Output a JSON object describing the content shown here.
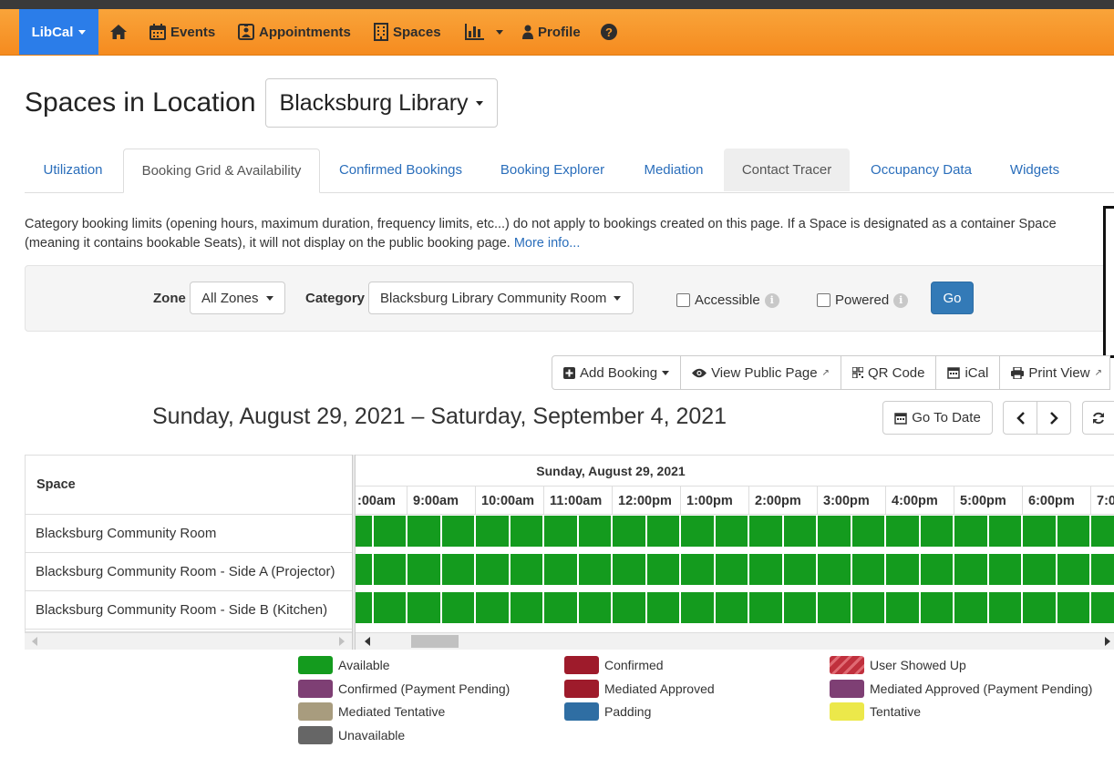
{
  "nav": {
    "brand": "LibCal",
    "items": [
      {
        "label": "Events",
        "icon": "calendar-icon"
      },
      {
        "label": "Appointments",
        "icon": "id-card-icon"
      },
      {
        "label": "Spaces",
        "icon": "building-icon"
      },
      {
        "label": "Profile",
        "icon": "user-icon"
      }
    ]
  },
  "page": {
    "title": "Spaces in Location",
    "location": "Blacksburg Library"
  },
  "tabs": [
    "Utilization",
    "Booking Grid & Availability",
    "Confirmed Bookings",
    "Booking Explorer",
    "Mediation",
    "Contact Tracer",
    "Occupancy Data",
    "Widgets"
  ],
  "notice": {
    "text": "Category booking limits (opening hours, maximum duration, frequency limits, etc...) do not apply to bookings created on this page. If a Space is designated as a container Space (meaning it contains bookable Seats), it will not display on the public booking page. ",
    "link": "More info..."
  },
  "filters": {
    "zone_label": "Zone",
    "zone_value": "All Zones",
    "category_label": "Category",
    "category_value": "Blacksburg Library Community Room",
    "accessible_label": "Accessible",
    "powered_label": "Powered",
    "go_label": "Go"
  },
  "toolbar": {
    "add_booking": "Add Booking",
    "view_public": "View Public Page",
    "qr_code": "QR Code",
    "ical": "iCal",
    "print_view": "Print View"
  },
  "range": {
    "title": "Sunday, August 29, 2021 – Saturday, September 4, 2021",
    "go_to_date": "Go To Date"
  },
  "grid": {
    "space_header": "Space",
    "day_label": "Sunday, August 29, 2021",
    "hours": [
      ":00am",
      "9:00am",
      "10:00am",
      "11:00am",
      "12:00pm",
      "1:00pm",
      "2:00pm",
      "3:00pm",
      "4:00pm",
      "5:00pm",
      "6:00pm",
      "7:0"
    ],
    "rows": [
      "Blacksburg Community Room",
      "Blacksburg Community Room - Side A (Projector)",
      "Blacksburg Community Room - Side B (Kitchen)"
    ]
  },
  "legend": [
    {
      "label": "Available",
      "color": "#149b1e"
    },
    {
      "label": "Confirmed",
      "color": "#9e1b2b"
    },
    {
      "label": "User Showed Up",
      "color": "#c0303d"
    },
    {
      "label": "Confirmed (Payment Pending)",
      "color": "#7e3f74"
    },
    {
      "label": "Mediated Approved",
      "color": "#9e1b2b"
    },
    {
      "label": "Mediated Approved (Payment Pending)",
      "color": "#7e3f74"
    },
    {
      "label": "Mediated Tentative",
      "color": "#a89c7e"
    },
    {
      "label": "Padding",
      "color": "#2f6ea3"
    },
    {
      "label": "Tentative",
      "color": "#ece84a"
    },
    {
      "label": "Unavailable",
      "color": "#666666"
    }
  ]
}
